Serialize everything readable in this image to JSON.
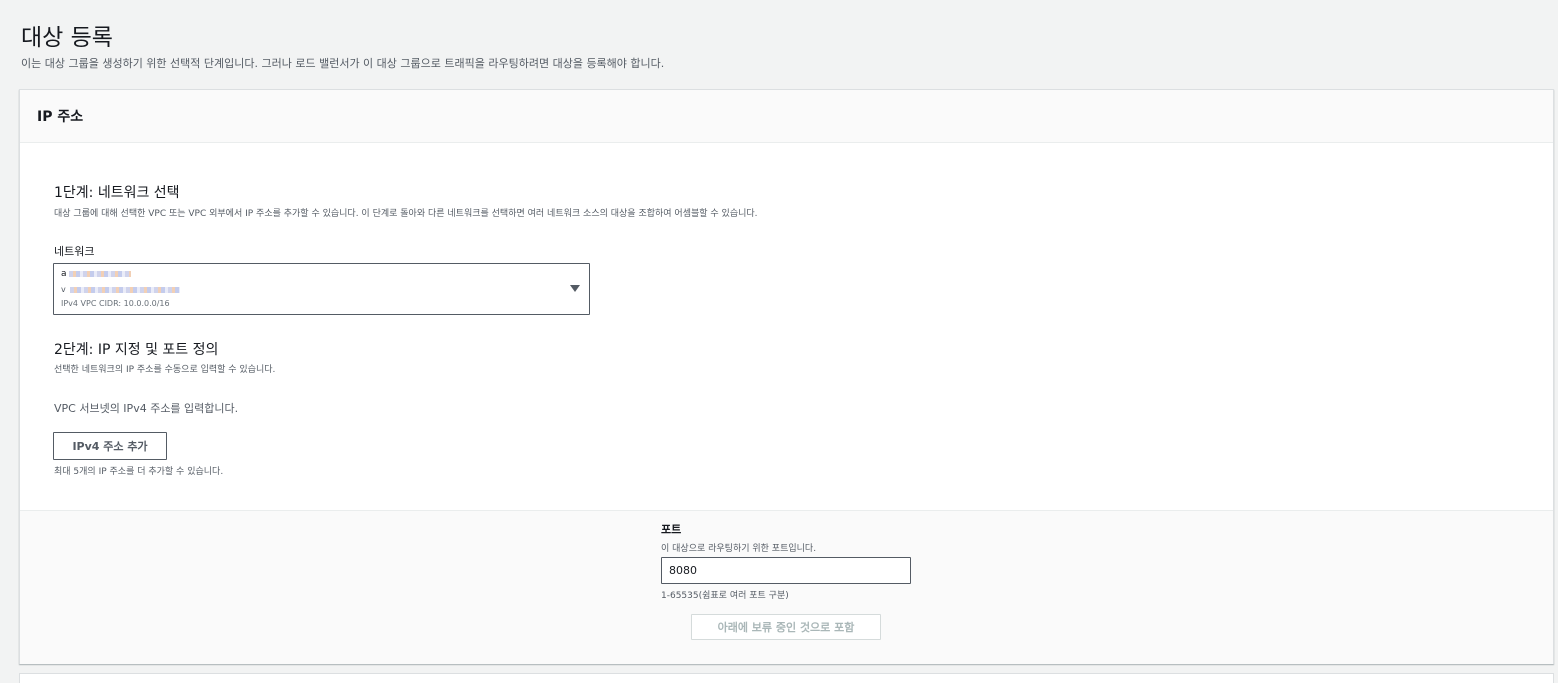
{
  "page": {
    "title": "대상 등록",
    "description": "이는 대상 그룹을 생성하기 위한 선택적 단계입니다. 그러나 로드 밸런서가 이 대상 그룹으로 트래픽을 라우팅하려면 대상을 등록해야 합니다."
  },
  "panel": {
    "title": "IP 주소",
    "step1": {
      "title": "1단계: 네트워크 선택",
      "description": "대상 그룹에 대해 선택한 VPC 또는 VPC 외부에서 IP 주소를 추가할 수 있습니다. 이 단계로 돌아와 다른 네트워크를 선택하면 여러 네트워크 소스의 대상을 조합하여 어셈블할 수 있습니다.",
      "network_label": "네트워크",
      "network_select": {
        "line1_prefix": "a",
        "line2_prefix": "v",
        "line3_prefix": "IPv4 VPC CIDR: 10.0.0.0/16",
        "caret_icon": "caret-down-icon"
      }
    },
    "step2": {
      "title": "2단계: IP 지정 및 포트 정의",
      "description": "선택한 네트워크의 IP 주소를 수동으로 입력할 수 있습니다.",
      "instruction": "VPC 서브넷의 IPv4 주소를 입력합니다.",
      "add_button": "IPv4 주소 추가",
      "add_hint": "최대 5개의 IP 주소를 더 추가할 수 있습니다."
    },
    "footer": {
      "port_label": "포트",
      "port_description": "이 대상으로 라우팅하기 위한 포트입니다.",
      "port_value": "8080",
      "port_hint": "1-65535(쉼표로 여러 포트 구분)",
      "include_button": "아래에 보류 중인 것으로 포함"
    }
  }
}
